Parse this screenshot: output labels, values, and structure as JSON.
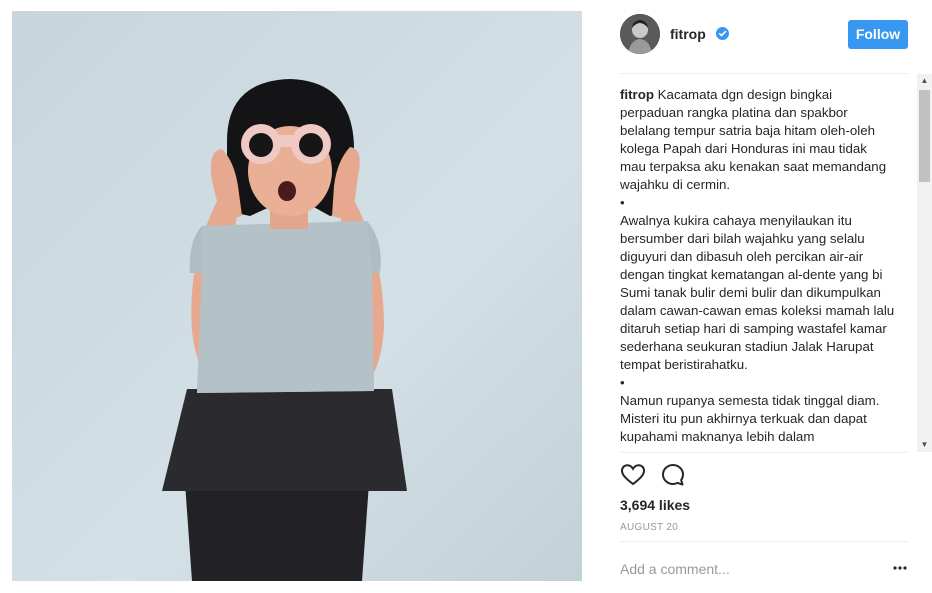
{
  "post": {
    "username": "fitrop",
    "follow_label": "Follow",
    "caption_username": "fitrop",
    "caption_text": " Kacamata dgn design bingkai perpaduan rangka platina dan spakbor belalang tempur satria baja hitam oleh-oleh kolega Papah dari Honduras ini mau tidak mau terpaksa aku kenakan saat memandang wajahku di cermin.\n•\nAwalnya kukira cahaya menyilaukan itu bersumber dari bilah wajahku yang selalu diguyuri dan dibasuh oleh percikan air-air dengan tingkat kematangan al-dente yang bi Sumi tanak bulir demi bulir dan dikumpulkan dalam cawan-cawan emas koleksi mamah lalu ditaruh setiap hari di samping wastafel kamar sederhana seukuran stadiun Jalak Harupat tempat beristirahatku.\n•\nNamun rupanya semesta tidak tinggal diam. Misteri itu pun akhirnya terkuak dan dapat kupahami maknanya lebih dalam",
    "likes": "3,694 likes",
    "date": "AUGUST 20",
    "comment_placeholder": "Add a comment..."
  },
  "icons": {
    "verified": "verified-badge-icon",
    "like": "heart-icon",
    "comment": "comment-bubble-icon",
    "more": "more-options-icon"
  },
  "colors": {
    "accent": "#3897f0",
    "text": "#262626",
    "muted": "#999999",
    "divider": "#efefef"
  }
}
